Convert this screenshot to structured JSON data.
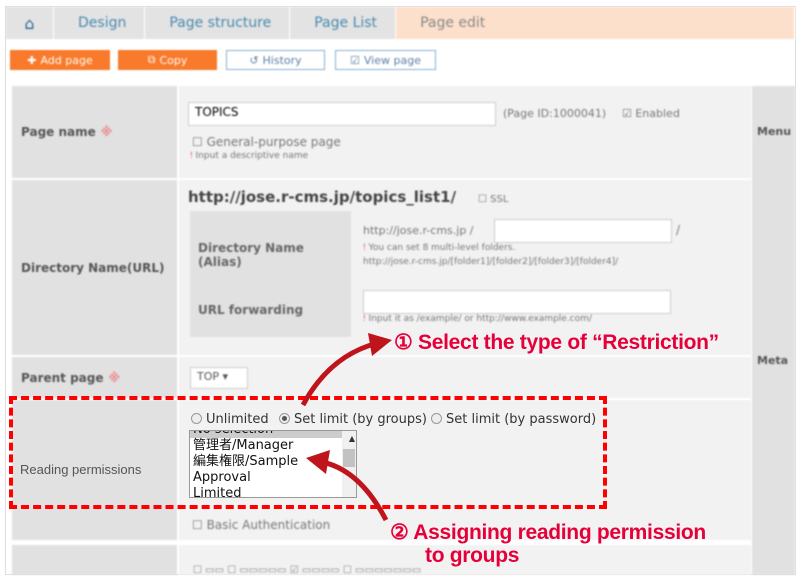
{
  "breadcrumb": {
    "items": [
      "Design",
      "Page structure",
      "Page List",
      "Page edit"
    ]
  },
  "toolbar": {
    "add": "Add page",
    "copy": "Copy",
    "history": "History",
    "view": "View page"
  },
  "page_name": {
    "label": "Page name",
    "required_mark": "※",
    "value": "TOPICS",
    "page_id": "(Page ID:1000041)",
    "enabled": "Enabled",
    "general": "General-purpose page",
    "hint": "Input a descriptive name"
  },
  "directory": {
    "label": "Directory Name(URL)",
    "url": "http://jose.r-cms.jp/topics_list1/",
    "ssl": "SSL",
    "alias_label": "Directory Name (Alias)",
    "alias_prefix": "http://jose.r-cms.jp /",
    "alias_suffix": "/",
    "alias_hint1": "You can set 8 multi-level folders.",
    "alias_hint2": "http://jose.r-cms.jp/[folder1]/[folder2]/[folder3]/[folder4]/",
    "forward_label": "URL forwarding",
    "forward_hint": "Input it as /example/ or http://www.example.com/"
  },
  "parent": {
    "label": "Parent page",
    "required_mark": "※",
    "value": "TOP ▾"
  },
  "reading": {
    "label": "Reading permissions",
    "options": [
      "Unlimited",
      "Set limit (by groups)",
      "Set limit (by password)"
    ],
    "selected": 1,
    "groups": [
      "No selection",
      "管理者/Manager",
      "編集権限/Sample",
      "Approval",
      "Limited"
    ],
    "basic_auth": "Basic Authentication"
  },
  "right": {
    "r1": "Menu",
    "r2": "Meta"
  },
  "annotations": {
    "a1": "① Select the type of “Restriction”",
    "a2_line1": "② Assigning reading permission",
    "a2_line2": "to groups"
  },
  "colors": {
    "accent": "#f87a2a",
    "annotation": "#e5003a",
    "dash": "#ff0000"
  }
}
